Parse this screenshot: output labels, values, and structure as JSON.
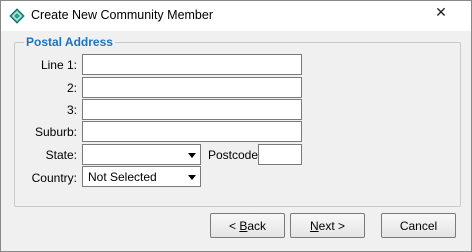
{
  "window": {
    "title": "Create New Community Member",
    "close_glyph": "✕"
  },
  "group": {
    "legend": "Postal Address"
  },
  "fields": {
    "line1_label": "Line 1:",
    "line1_value": "",
    "line2_label": "2:",
    "line2_value": "",
    "line3_label": "3:",
    "line3_value": "",
    "suburb_label": "Suburb:",
    "suburb_value": "",
    "state_label": "State:",
    "state_value": "",
    "postcode_label": "Postcode:",
    "postcode_value": "",
    "country_label": "Country:",
    "country_value": "Not Selected"
  },
  "buttons": {
    "back_prefix": "< ",
    "back_access": "B",
    "back_rest": "ack",
    "next_access": "N",
    "next_rest": "ext >",
    "cancel": "Cancel"
  },
  "colors": {
    "legend": "#1e73be",
    "window_bg": "#f0f0f0",
    "icon": "#2a9d8f"
  }
}
